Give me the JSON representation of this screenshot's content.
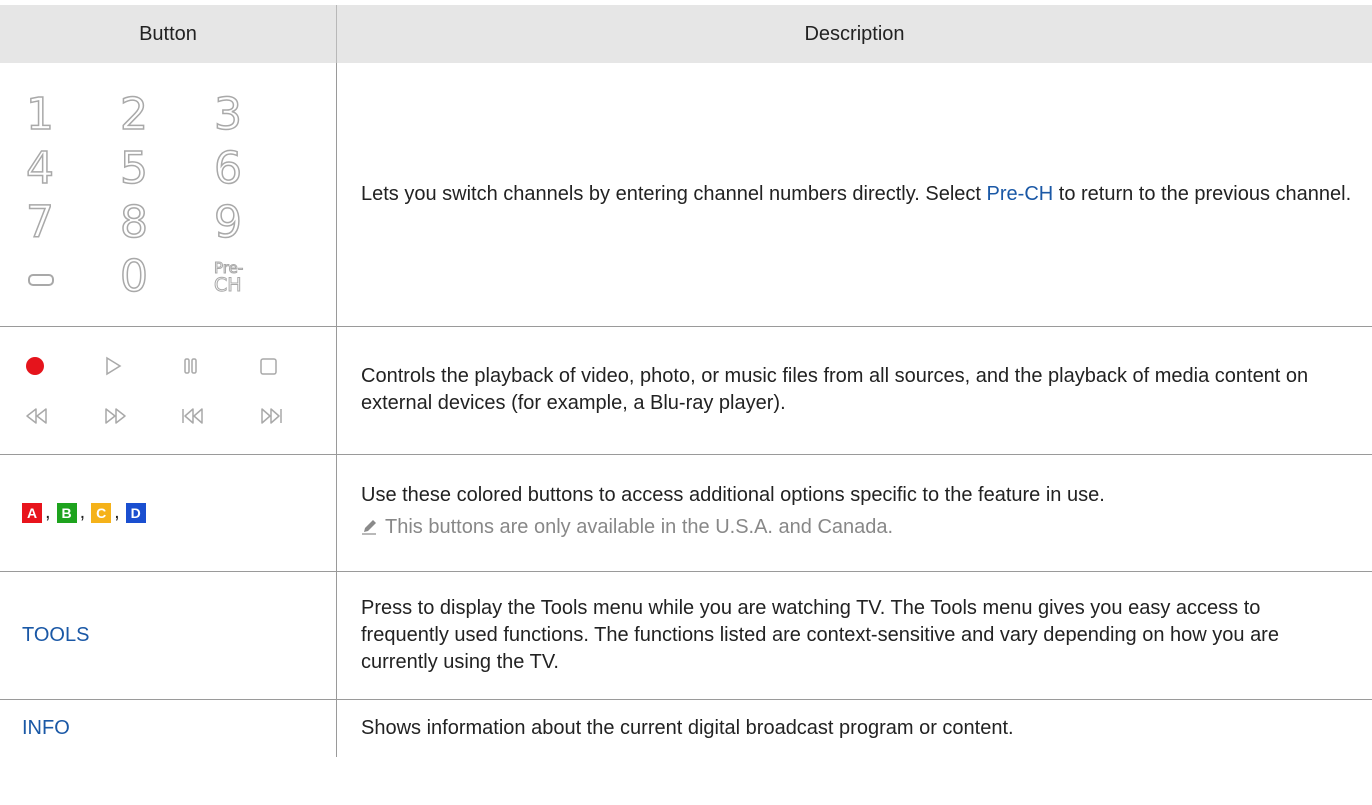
{
  "header": {
    "col_button": "Button",
    "col_description": "Description"
  },
  "rows": {
    "numbers": {
      "keys": [
        "1",
        "2",
        "3",
        "4",
        "5",
        "6",
        "7",
        "8",
        "9",
        "0"
      ],
      "prech_top": "Pre-",
      "prech_bottom": "CH",
      "desc_before": "Lets you switch channels by entering channel numbers directly. Select ",
      "desc_highlight": "Pre-CH",
      "desc_after": " to return to the previous channel."
    },
    "playback": {
      "icons": [
        "record-icon",
        "play-icon",
        "pause-icon",
        "stop-icon",
        "rewind-icon",
        "fast-forward-icon",
        "previous-icon",
        "next-icon"
      ],
      "desc": "Controls the playback of video, photo, or music files from all sources, and the playback of media content on external devices (for example, a Blu-ray player)."
    },
    "color_buttons": {
      "buttons": [
        {
          "label": "A",
          "color": "#e8141c"
        },
        {
          "label": "B",
          "color": "#1ea31e"
        },
        {
          "label": "C",
          "color": "#f5b21a"
        },
        {
          "label": "D",
          "color": "#1a4fd0"
        }
      ],
      "separator": ",",
      "desc": "Use these colored buttons to access additional options specific to the feature in use.",
      "note": "This buttons are only available in the U.S.A. and Canada.",
      "note_icon": "pencil-icon"
    },
    "tools": {
      "label": "TOOLS",
      "desc": "Press to display the Tools menu while you are watching TV. The Tools menu gives you easy access to frequently used functions. The functions listed are context-sensitive and vary depending on how you are currently using the TV."
    },
    "info": {
      "label": "INFO",
      "desc": "Shows information about the current digital broadcast program or content."
    }
  },
  "colors": {
    "accent_text": "#1a58a6",
    "header_bg": "#e6e6e6",
    "record_red": "#e5141c"
  }
}
